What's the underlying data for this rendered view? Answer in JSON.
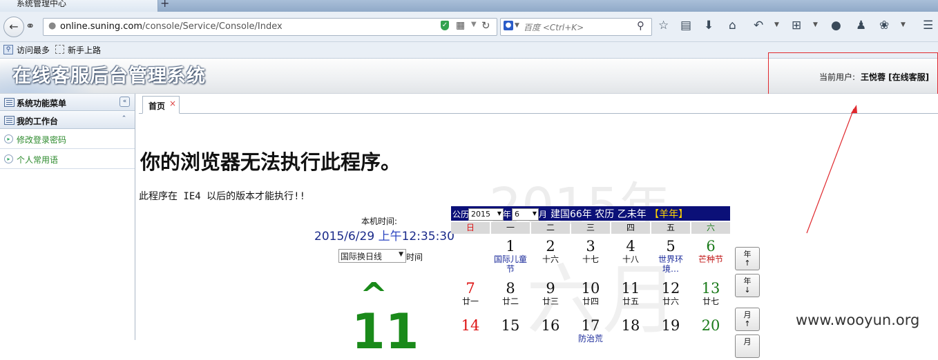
{
  "browser": {
    "tab_title": "系统管理中心",
    "new_tab": "+",
    "url_host": "online.suning.com",
    "url_path": "/console/Service/Console/Index",
    "search_placeholder": "百度 <Ctrl+K>",
    "bookmarks": [
      "访问最多",
      "新手上路"
    ]
  },
  "app": {
    "title": "在线客服后台管理系统",
    "current_user_label": "当前用户:",
    "current_user_name": "王悦蓉 [在线客服]"
  },
  "sidebar": {
    "menu_title": "系统功能菜单",
    "workbench_title": "我的工作台",
    "items": [
      "修改登录密码",
      "个人常用语"
    ]
  },
  "content_tab": {
    "label": "首页",
    "close": "×"
  },
  "page": {
    "watermark_year": "2015年",
    "watermark_month": "六月",
    "error_title": "你的浏览器无法执行此程序。",
    "error_desc": "此程序在 IE4 以后的版本才能执行!!",
    "local_time_label": "本机时间:",
    "local_time_date": "2015/6/29",
    "local_time_ampm": "上午",
    "local_time_clock": "12:35:30",
    "timezone_value": "国际换日线",
    "timezone_suffix": "时间",
    "big_caret": "^",
    "big_digit": "11"
  },
  "calendar": {
    "gl_label": "公历",
    "year_value": "2015",
    "year_unit": "年",
    "month_value": "6",
    "month_unit": "月",
    "info_text": "建国66年 农历 乙未年",
    "zodiac": "【羊年】",
    "weekdays": [
      "日",
      "一",
      "二",
      "三",
      "四",
      "五",
      "六"
    ],
    "rows": [
      [
        null,
        {
          "n": "1",
          "l": "国际儿童节",
          "t": "fest"
        },
        {
          "n": "2",
          "l": "十六"
        },
        {
          "n": "3",
          "l": "十七"
        },
        {
          "n": "4",
          "l": "十八"
        },
        {
          "n": "5",
          "l": "世界环境…",
          "t": "fest"
        },
        {
          "n": "6",
          "l": "芒种节",
          "t": "term"
        }
      ],
      [
        {
          "n": "7",
          "l": "廿一"
        },
        {
          "n": "8",
          "l": "廿二"
        },
        {
          "n": "9",
          "l": "廿三"
        },
        {
          "n": "10",
          "l": "廿四"
        },
        {
          "n": "11",
          "l": "廿五"
        },
        {
          "n": "12",
          "l": "廿六"
        },
        {
          "n": "13",
          "l": "廿七"
        }
      ],
      [
        {
          "n": "14",
          "l": ""
        },
        {
          "n": "15",
          "l": ""
        },
        {
          "n": "16",
          "l": ""
        },
        {
          "n": "17",
          "l": "防治荒",
          "t": "fest"
        },
        {
          "n": "18",
          "l": ""
        },
        {
          "n": "19",
          "l": ""
        },
        {
          "n": "20",
          "l": ""
        }
      ]
    ],
    "nav_buttons": [
      {
        "label": "年",
        "arrow": "↑"
      },
      {
        "label": "年",
        "arrow": "↓"
      },
      {
        "label": "月",
        "arrow": "↑"
      },
      {
        "label": "月",
        "arrow": ""
      }
    ]
  },
  "annotation": {
    "watermark": "www.wooyun.org",
    "highlight_color": "#e0282d"
  }
}
